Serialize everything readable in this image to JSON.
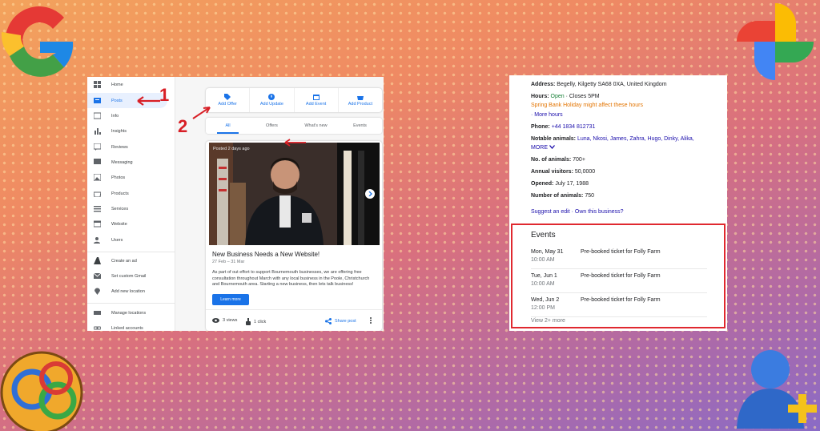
{
  "left_panel": {
    "sidebar": {
      "items": [
        {
          "label": "Home",
          "icon": "home-grid-icon"
        },
        {
          "label": "Posts",
          "icon": "posts-icon"
        },
        {
          "label": "Info",
          "icon": "info-icon"
        },
        {
          "label": "Insights",
          "icon": "insights-icon"
        },
        {
          "label": "Reviews",
          "icon": "reviews-icon"
        },
        {
          "label": "Messaging",
          "icon": "messaging-icon"
        },
        {
          "label": "Photos",
          "icon": "photos-icon"
        },
        {
          "label": "Products",
          "icon": "products-icon"
        },
        {
          "label": "Services",
          "icon": "services-icon"
        },
        {
          "label": "Website",
          "icon": "website-icon"
        },
        {
          "label": "Users",
          "icon": "users-icon"
        }
      ],
      "secondary_items": [
        {
          "label": "Create an ad",
          "icon": "ads-icon"
        },
        {
          "label": "Set custom Gmail",
          "icon": "gmail-icon"
        },
        {
          "label": "Add new location",
          "icon": "location-icon"
        }
      ],
      "tertiary_items": [
        {
          "label": "Manage locations",
          "icon": "manage-icon"
        },
        {
          "label": "Linked accounts",
          "icon": "link-icon"
        }
      ]
    },
    "actions": [
      "Add Offer",
      "Add Update",
      "Add Event",
      "Add Product"
    ],
    "tabs": [
      "All",
      "Offers",
      "What's new",
      "Events"
    ],
    "post": {
      "meta": "Posted 2 days ago",
      "title": "New Business Needs a New Website!",
      "date": "27 Feb – 31 Mar",
      "body": "As part of out effort to support Bournemouth businesses, we are offering free consultation throughout March with any local business in the Poole, Christchurch and Bournemouth area. Starting a new business, then lets talk business!",
      "button": "Learn more",
      "views": "3 views",
      "clicks": "1 click",
      "share": "Share post"
    }
  },
  "annotations": {
    "one": "1",
    "two": "2"
  },
  "right_panel": {
    "address_label": "Address:",
    "address": "Begelly, Kilgetty SA68 0XA, United Kingdom",
    "hours_label": "Hours:",
    "hours_status": "Open",
    "hours_close": "· Closes 5PM",
    "holiday_note": "Spring Bank Holiday might affect these hours",
    "more_hours": "· More hours",
    "phone_label": "Phone:",
    "phone": "+44 1834 812731",
    "animals_label": "Notable animals:",
    "animals": "Luna, Nkosi, James, Zahra, Hugo, Dinky, Alika,",
    "more": "MORE",
    "no_animals_label": "No. of animals:",
    "no_animals": "700+",
    "visitors_label": "Annual visitors:",
    "visitors": "50,0000",
    "opened_label": "Opened:",
    "opened": "July 17, 1988",
    "num_animals_label": "Number of animals:",
    "num_animals": "750",
    "suggest": "Suggest an edit · Own this business?",
    "events": {
      "title": "Events",
      "rows": [
        {
          "date": "Mon, May 31",
          "time": "10:00 AM",
          "name": "Pre-booked ticket for Folly Farm"
        },
        {
          "date": "Tue, Jun 1",
          "time": "10:00 AM",
          "name": "Pre-booked ticket for Folly Farm"
        },
        {
          "date": "Wed, Jun 2",
          "time": "12:00 PM",
          "name": "Pre-booked ticket for Folly Farm"
        }
      ],
      "view_more": "View 2+ more"
    }
  },
  "colors": {
    "accent": "#1a73e8",
    "annotation_red": "#d81f26",
    "open_green": "#188038",
    "holiday_orange": "#e37400"
  }
}
